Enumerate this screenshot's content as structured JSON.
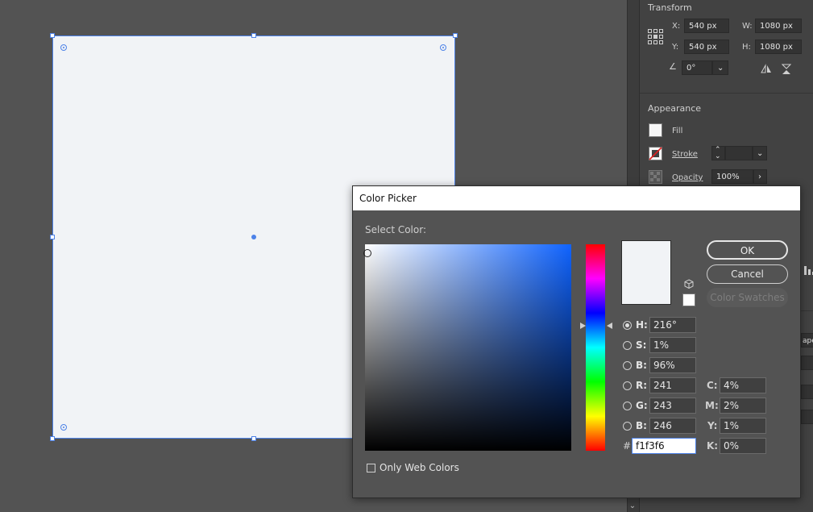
{
  "colors": {
    "artboard_fill": "#f1f3f6",
    "selection": "#4d82e8",
    "pure_hue": "#0f63ff"
  },
  "transform": {
    "title": "Transform",
    "x_label": "X:",
    "x_value": "540 px",
    "y_label": "Y:",
    "y_value": "540 px",
    "w_label": "W:",
    "w_value": "1080 px",
    "h_label": "H:",
    "h_value": "1080 px",
    "angle_value": "0°"
  },
  "appearance": {
    "title": "Appearance",
    "fill_label": "Fill",
    "stroke_label": "Stroke",
    "opacity_label": "Opacity",
    "opacity_value": "100%",
    "partial_text": "ape"
  },
  "dialog": {
    "title": "Color Picker",
    "select_color_label": "Select Color:",
    "ok_label": "OK",
    "cancel_label": "Cancel",
    "swatches_label": "Color Swatches",
    "h_label": "H:",
    "h_value": "216°",
    "s_label": "S:",
    "s_value": "1%",
    "b_label": "B:",
    "b_value": "96%",
    "r_label": "R:",
    "r_value": "241",
    "g_label": "G:",
    "g_value": "243",
    "bb_label": "B:",
    "bb_value": "246",
    "hash_label": "#",
    "hex_value": "f1f3f6",
    "c_label": "C:",
    "c_value": "4%",
    "m_label": "M:",
    "m_value": "2%",
    "y_label": "Y:",
    "y_value": "1%",
    "k_label": "K:",
    "k_value": "0%",
    "web_colors_label": "Only Web Colors"
  }
}
